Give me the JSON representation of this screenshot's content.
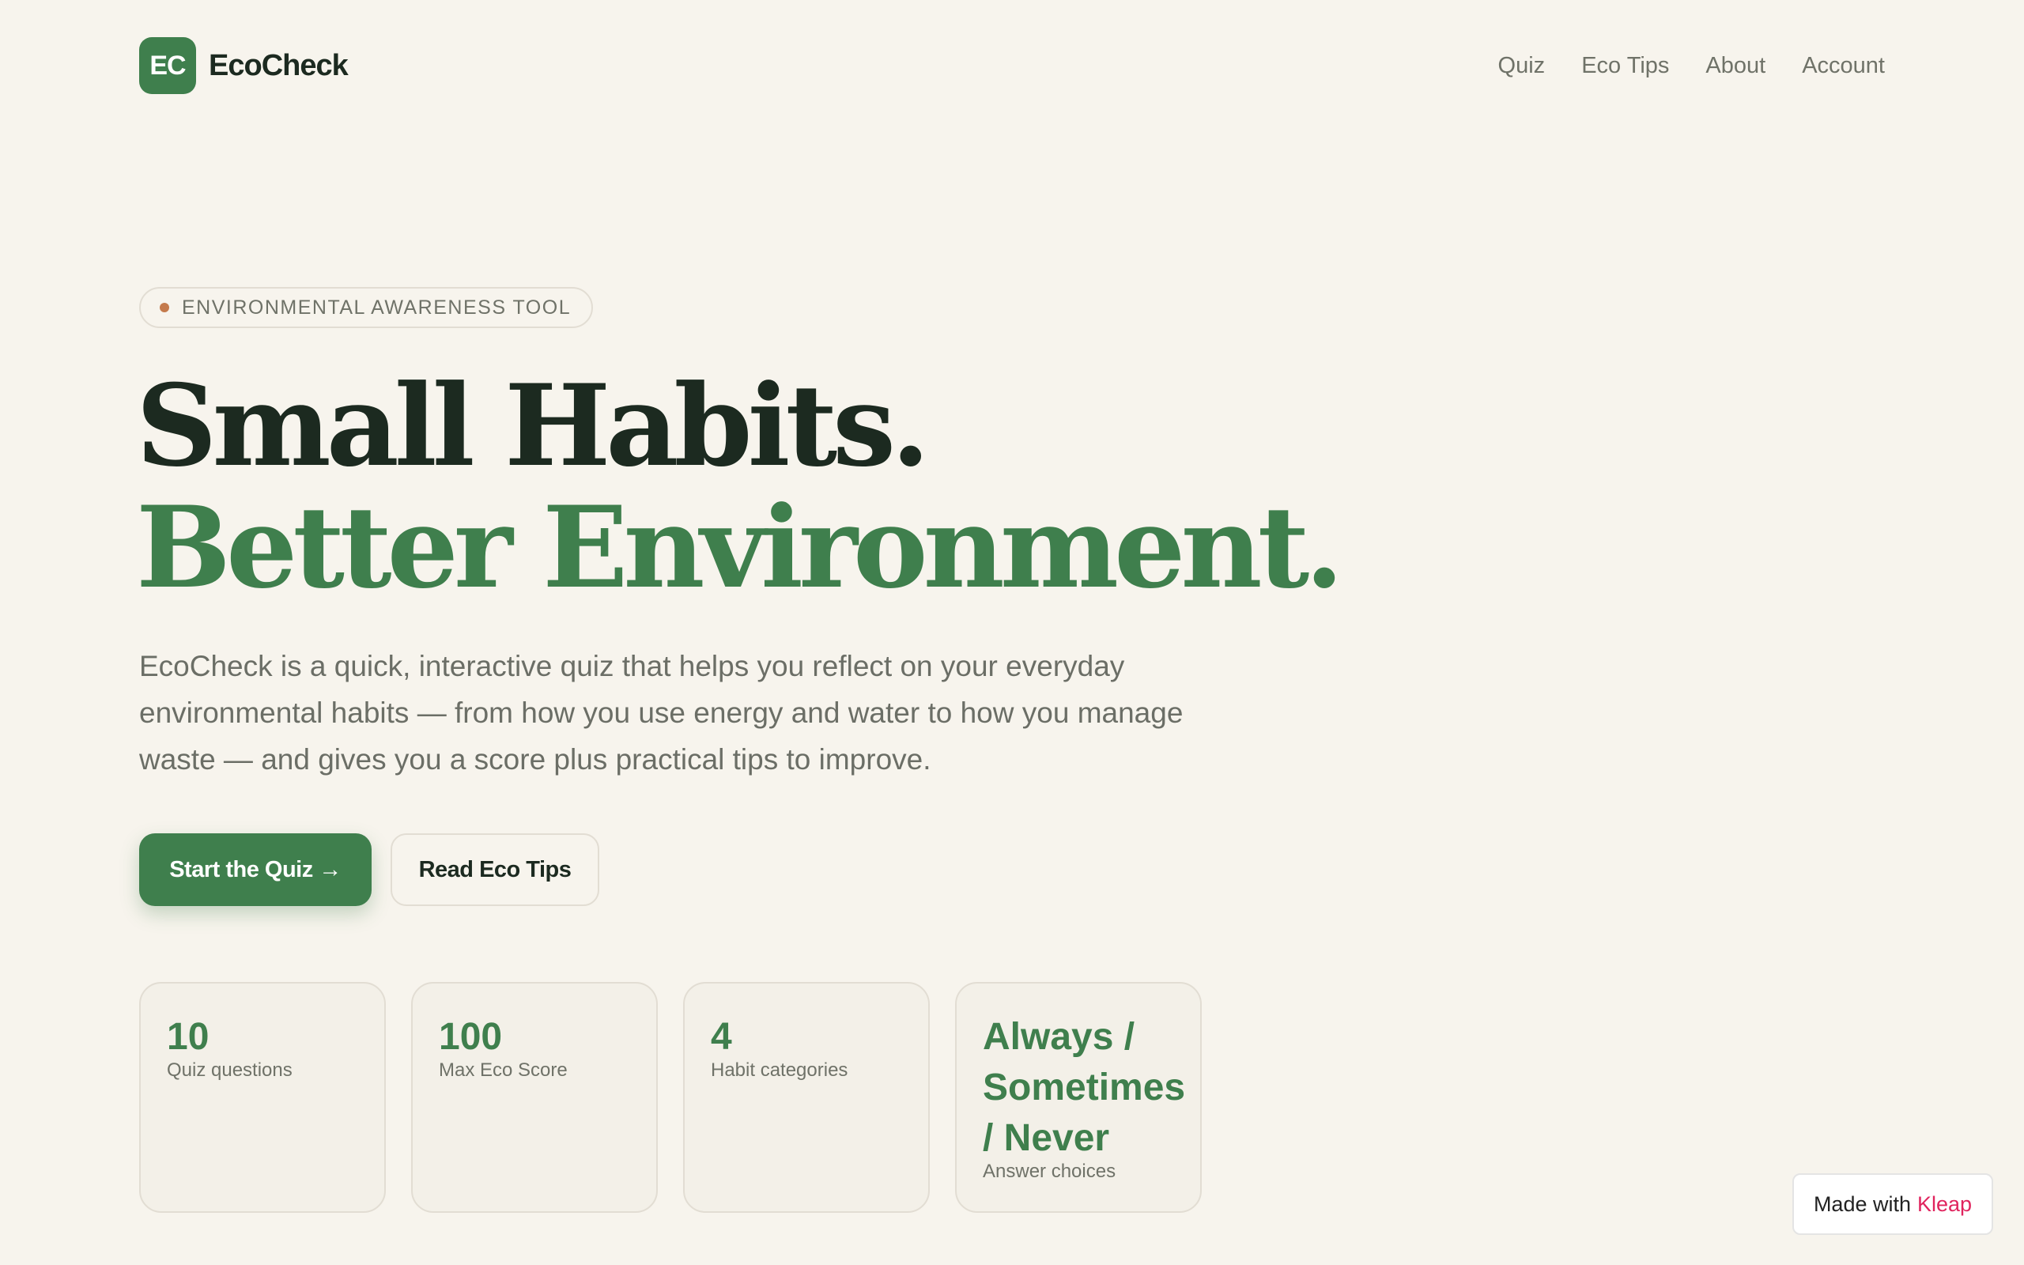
{
  "header": {
    "logo_text": "EC",
    "brand": "EcoCheck",
    "nav": [
      "Quiz",
      "Eco Tips",
      "About",
      "Account"
    ]
  },
  "hero": {
    "badge": "ENVIRONMENTAL AWARENESS TOOL",
    "headline_line1": "Small Habits.",
    "headline_line2": "Better Environment.",
    "description": "EcoCheck is a quick, interactive quiz that helps you reflect on your everyday environmental habits — from how you use energy and water to how you manage waste — and gives you a score plus practical tips to improve.",
    "primary_button": "Start the Quiz →",
    "secondary_button": "Read Eco Tips"
  },
  "stats": [
    {
      "value": "10",
      "label": "Quiz questions"
    },
    {
      "value": "100",
      "label": "Max Eco Score"
    },
    {
      "value": "4",
      "label": "Habit categories"
    },
    {
      "value": "Always / Sometimes / Never",
      "label": "Answer choices"
    }
  ],
  "footer_badge": {
    "prefix": "Made with",
    "brand": "Kleap"
  },
  "colors": {
    "background": "#f7f4ed",
    "accent": "#3f7f4d",
    "dark_text": "#1c2a20",
    "muted_text": "#6f7268",
    "badge_dot": "#c47a4c",
    "kleap": "#e0245e"
  }
}
